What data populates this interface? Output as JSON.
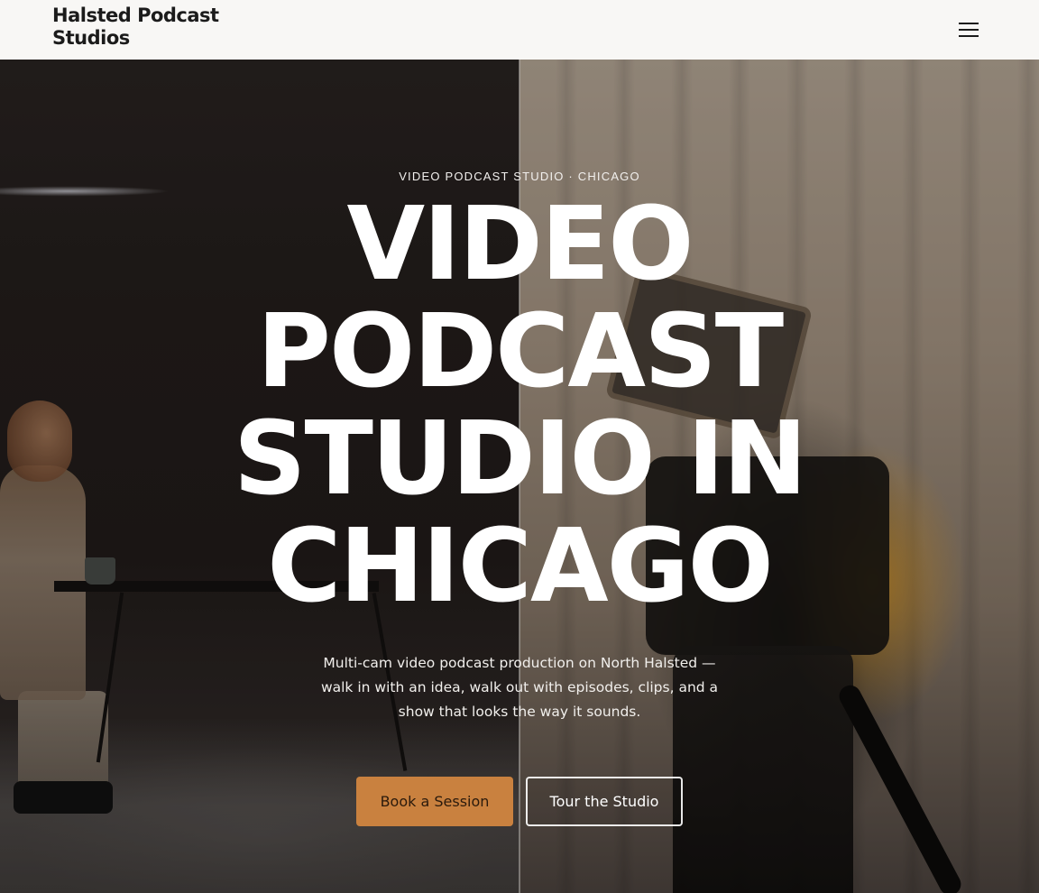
{
  "header": {
    "brand": "Halsted Podcast Studios",
    "menu_icon": "hamburger-menu-icon"
  },
  "hero": {
    "eyebrow": "VIDEO PODCAST STUDIO · CHICAGO",
    "headline_lines": [
      "VIDEO",
      "PODCAST",
      "STUDIO IN",
      "CHICAGO"
    ],
    "subtitle": "Multi-cam video podcast production on North Halsted — walk in with an idea, walk out with episodes, clips, and a show that looks the way it sounds.",
    "primary_cta": "Book a Session",
    "secondary_cta": "Tour the Studio"
  },
  "colors": {
    "header_bg": "#f8f7f5",
    "accent": "#c9813f",
    "text_light": "#ffffff"
  }
}
